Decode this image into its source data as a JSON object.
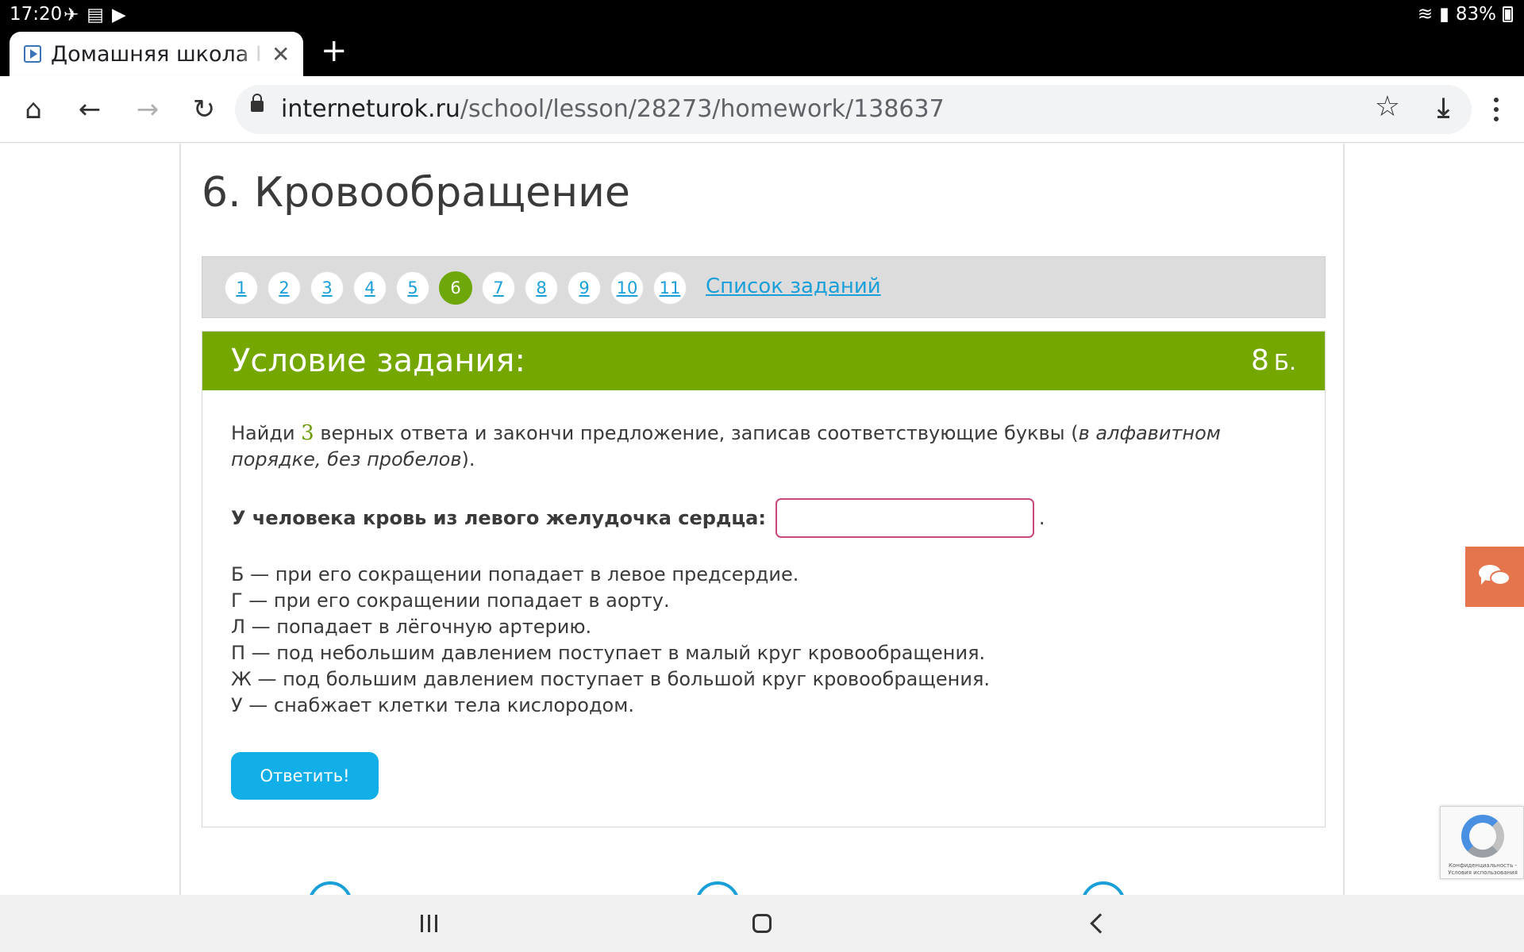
{
  "status_bar": {
    "time": "17:20",
    "battery": "83%"
  },
  "browser": {
    "tab_title": "Домашняя школа InternetUrok",
    "url_host": "interneturok.ru",
    "url_path": "/school/lesson/28273/homework/138637"
  },
  "lesson": {
    "title": "6. Кровообращение"
  },
  "task_nav": {
    "numbers": [
      "1",
      "2",
      "3",
      "4",
      "5",
      "6",
      "7",
      "8",
      "9",
      "10",
      "11"
    ],
    "active": "6",
    "list_link": "Список заданий"
  },
  "task": {
    "header_title": "Условие задания:",
    "points_value": "8",
    "points_unit": "Б.",
    "instruction_pre": "Найди ",
    "instruction_count": "3",
    "instruction_mid": " верных ответа и закончи предложение, записав соответствующие буквы (",
    "instruction_italic": "в алфавитном порядке, без пробелов",
    "instruction_post": ").",
    "question_label": "У человека кровь из левого желудочка сердца:",
    "answer_value": "",
    "question_suffix": ".",
    "options": [
      "Б — при его сокращении попадает в левое предсердие.",
      "Г — при его сокращении попадает в аорту.",
      "Л — попадает в лёгочную артерию.",
      "П — под небольшим давлением поступает в малый круг кровообращения.",
      "Ж — под большим давлением поступает в большой круг кровообращения.",
      "У — снабжает клетки тела кислородом."
    ],
    "answer_button": "Ответить!"
  },
  "recaptcha": {
    "text": "Конфиденциальность - Условия использования"
  },
  "colors": {
    "green": "#74a800",
    "active_num": "#6ea70a",
    "link": "#1a9fd9",
    "button": "#11aee7",
    "chat": "#e4754c",
    "input_border": "#c9487e"
  }
}
